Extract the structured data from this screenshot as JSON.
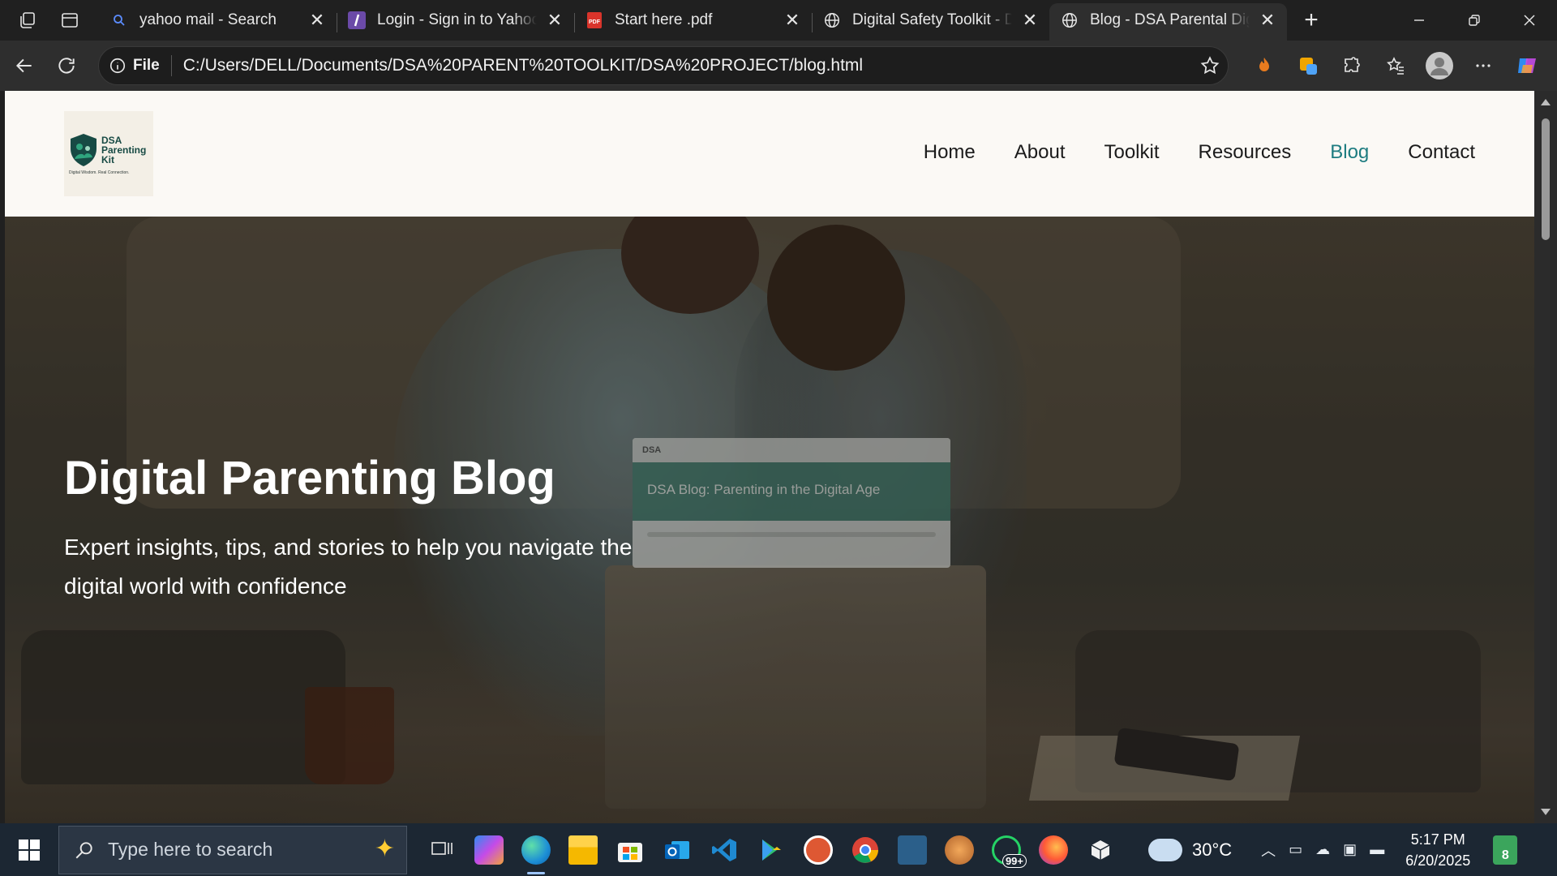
{
  "browser": {
    "tabs": [
      {
        "title": "yahoo mail - Search",
        "favicon": "search-icon",
        "active": false
      },
      {
        "title": "Login - Sign in to Yahoo",
        "favicon": "yahoo-icon",
        "active": false
      },
      {
        "title": "Start here .pdf",
        "favicon": "pdf-icon",
        "active": false
      },
      {
        "title": "Digital Safety Toolkit - DSA",
        "favicon": "globe-icon",
        "active": false
      },
      {
        "title": "Blog - DSA Parental Digital",
        "favicon": "globe-icon",
        "active": true
      }
    ],
    "address": {
      "scheme_label": "File",
      "url": "C:/Users/DELL/Documents/DSA%20PARENT%20TOOLKIT/DSA%20PROJECT/blog.html"
    }
  },
  "site": {
    "logo": {
      "line1": "DSA",
      "line2": "Parenting",
      "line3": "Kit",
      "tagline": "Digital Wisdom. Real Connection."
    },
    "nav": [
      "Home",
      "About",
      "Toolkit",
      "Resources",
      "Blog",
      "Contact"
    ],
    "current_nav": "Blog",
    "accent_color": "#1d7c80",
    "hero": {
      "title": "Digital Parenting Blog",
      "subtitle": "Expert insights, tips, and stories to help you navigate the digital world with confidence",
      "screen_brand": "DSA",
      "screen_heading": "DSA Blog: Parenting in the Digital Age"
    }
  },
  "taskbar": {
    "search_placeholder": "Type here to search",
    "weather": "30°C",
    "time": "5:17 PM",
    "date": "6/20/2025",
    "chat_badge": "99+",
    "notification_count": "8"
  }
}
